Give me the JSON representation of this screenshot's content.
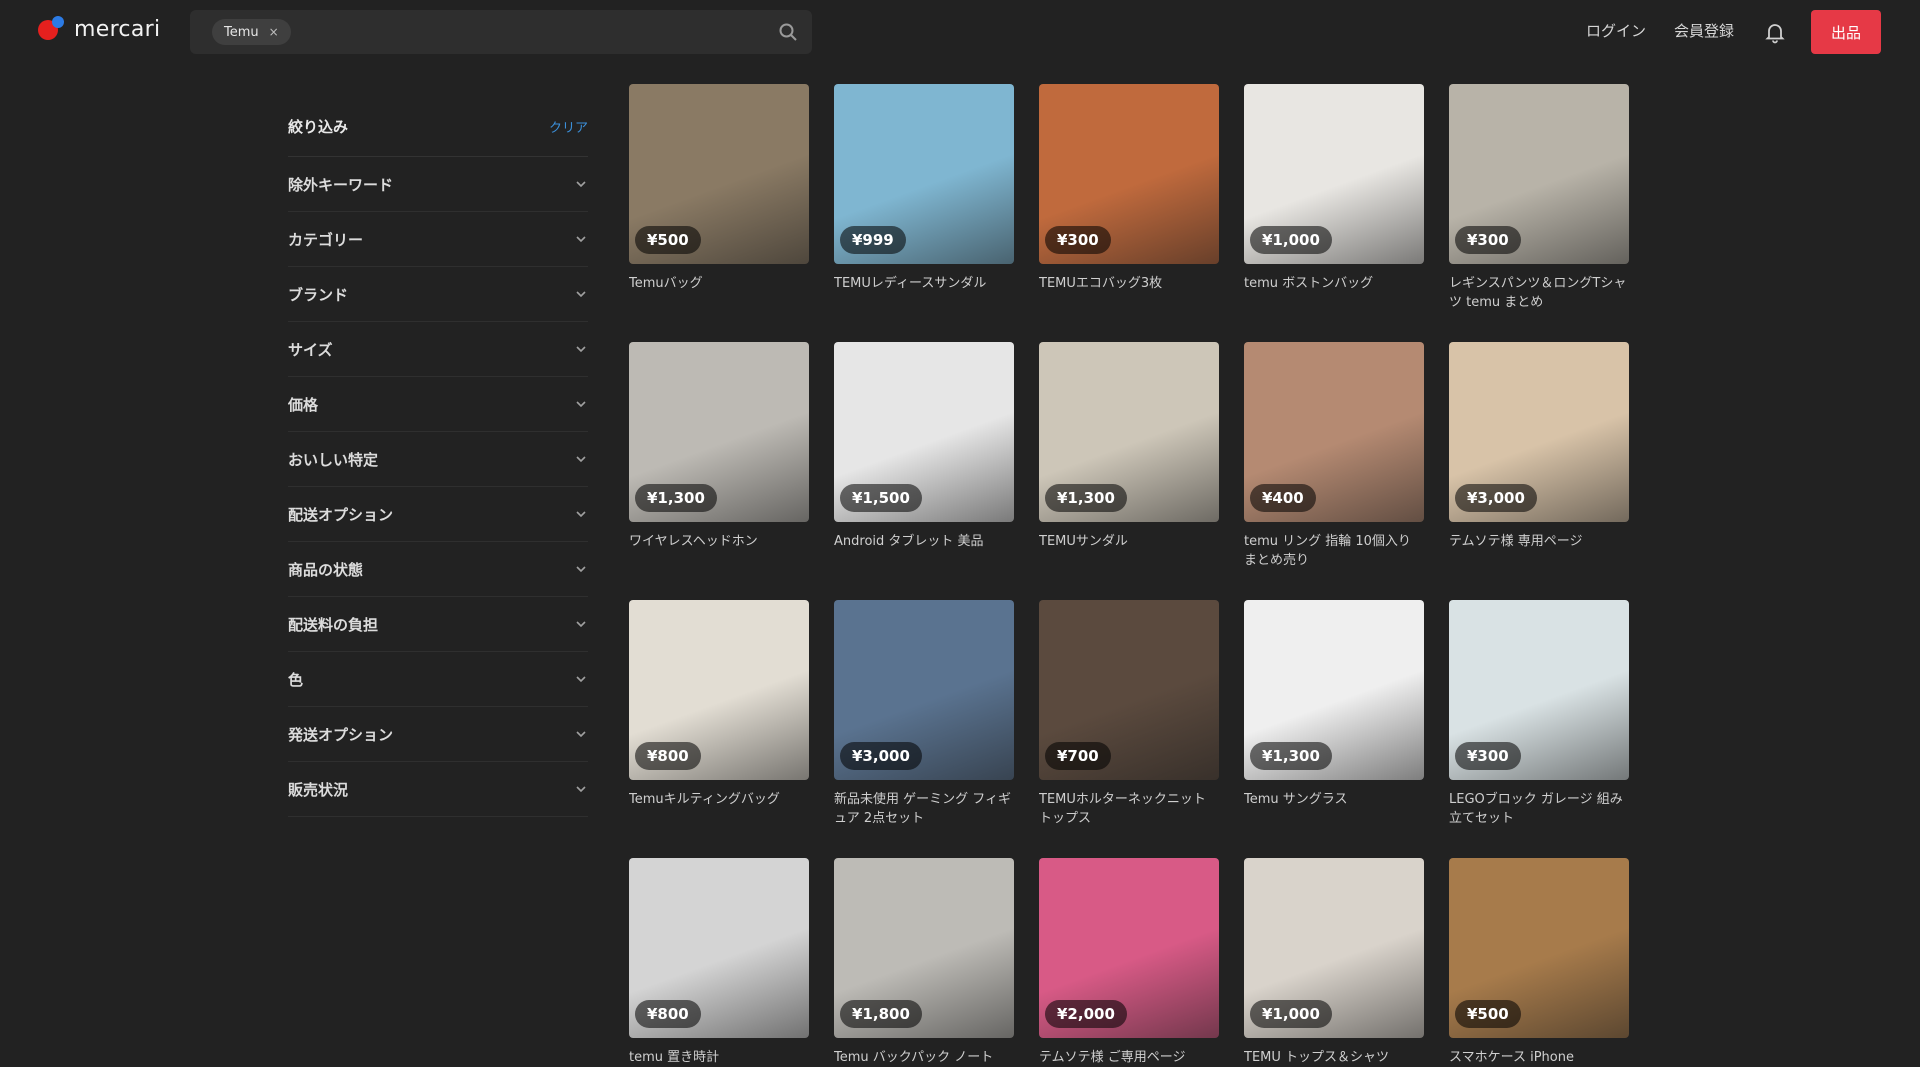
{
  "header": {
    "logo_text": "mercari",
    "search_chip": "Temu",
    "search_chip_close": "×",
    "login": "ログイン",
    "signup": "会員登録",
    "sell_button": "出品"
  },
  "sidebar": {
    "title": "絞り込み",
    "clear": "クリア",
    "filters": [
      "除外キーワード",
      "カテゴリー",
      "ブランド",
      "サイズ",
      "価格",
      "おいしい特定",
      "配送オプション",
      "商品の状態",
      "配送料の負担",
      "色",
      "発送オプション",
      "販売状況"
    ]
  },
  "products": [
    {
      "price": "¥500",
      "title": "Temuバッグ",
      "bg": "#8a7a64"
    },
    {
      "price": "¥999",
      "title": "TEMUレディースサンダル",
      "bg": "#7fb6d1"
    },
    {
      "price": "¥300",
      "title": "TEMUエコバッグ3枚",
      "bg": "#c06a3d"
    },
    {
      "price": "¥1,000",
      "title": "temu ボストンバッグ",
      "bg": "#e8e6e2"
    },
    {
      "price": "¥300",
      "title": "レギンスパンツ＆ロングTシャツ temu まとめ",
      "bg": "#b8b3a8"
    },
    {
      "price": "¥1,300",
      "title": "ワイヤレスヘッドホン",
      "bg": "#bdbab4"
    },
    {
      "price": "¥1,500",
      "title": "Android タブレット 美品",
      "bg": "#e6e6e6"
    },
    {
      "price": "¥1,300",
      "title": "TEMUサンダル",
      "bg": "#cdc6b8"
    },
    {
      "price": "¥400",
      "title": "temu リング 指輪 10個入り まとめ売り",
      "bg": "#b58a72"
    },
    {
      "price": "¥3,000",
      "title": "テムソテ様 専用ページ",
      "bg": "#d8c3a8"
    },
    {
      "price": "¥800",
      "title": "Temuキルティングバッグ",
      "bg": "#e2ddd3"
    },
    {
      "price": "¥3,000",
      "title": "新品未使用 ゲーミング フィギュア 2点セット",
      "bg": "#5a7390"
    },
    {
      "price": "¥700",
      "title": "TEMUホルターネックニット トップス",
      "bg": "#5b4a3e"
    },
    {
      "price": "¥1,300",
      "title": "Temu サングラス",
      "bg": "#efefef"
    },
    {
      "price": "¥300",
      "title": "LEGOブロック ガレージ 組み立てセット",
      "bg": "#d9e2e4"
    },
    {
      "price": "¥800",
      "title": "temu 置き時計",
      "bg": "#d4d4d4"
    },
    {
      "price": "¥1,800",
      "title": "Temu バックパック ノート",
      "bg": "#bdbbb6"
    },
    {
      "price": "¥2,000",
      "title": "テムソテ様 ご専用ページ",
      "bg": "#d85a86"
    },
    {
      "price": "¥1,000",
      "title": "TEMU トップス＆シャツ",
      "bg": "#d9d3cb"
    },
    {
      "price": "¥500",
      "title": "スマホケース iPhone",
      "bg": "#a77b4b"
    }
  ]
}
